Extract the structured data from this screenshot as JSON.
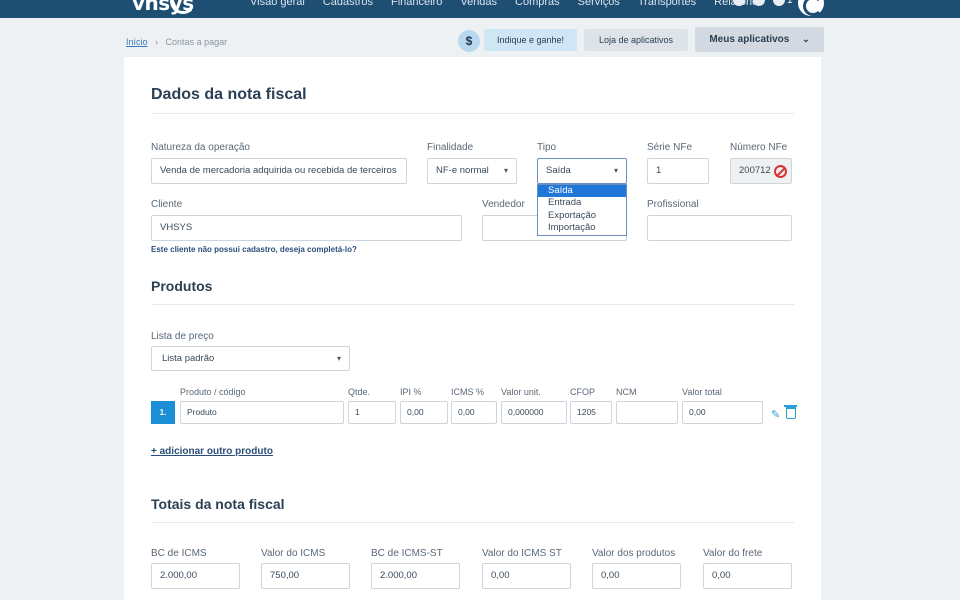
{
  "header": {
    "logo_text": "vhsys",
    "nav": [
      "Visão geral",
      "Cadastros",
      "Financeiro",
      "Vendas",
      "Compras",
      "Serviços",
      "Transportes",
      "Relatórios"
    ],
    "notification_count": "1"
  },
  "breadcrumb": {
    "home": "Início",
    "separator": "›",
    "current": "Contas a pagar"
  },
  "actions": {
    "dollar_symbol": "$",
    "indique": "Indique e ganhe!",
    "loja": "Loja de aplicativos",
    "meus": "Meus aplicativos",
    "meus_chevron": "⌄"
  },
  "form": {
    "title": "Dados da nota fiscal",
    "natureza": {
      "label": "Natureza da operação",
      "value": "Venda de mercadoria adquirida ou recebida de terceiros"
    },
    "finalidade": {
      "label": "Finalidade",
      "value": "NF-e normal"
    },
    "tipo": {
      "label": "Tipo",
      "value": "Saída",
      "options": [
        "Saída",
        "Entrada",
        "Exportação",
        "Importação"
      ]
    },
    "serie": {
      "label": "Série NFe",
      "value": "1"
    },
    "numero": {
      "label": "Número NFe",
      "value": "200712"
    },
    "cliente": {
      "label": "Cliente",
      "value": "VHSYS",
      "hint": "Este cliente não possui cadastro, deseja completá-lo?"
    },
    "vendedor": {
      "label": "Vendedor",
      "value": ""
    },
    "profissional": {
      "label": "Profissional",
      "value": ""
    }
  },
  "produtos": {
    "title": "Produtos",
    "lista_label": "Lista de preço",
    "lista_value": "Lista padrão",
    "columns": [
      "Produto / código",
      "Qtde.",
      "IPI %",
      "ICMS %",
      "Valor unit.",
      "CFOP",
      "NCM",
      "Valor total"
    ],
    "row": {
      "index": "1.",
      "produto": "Produto",
      "qtde": "1",
      "ipi": "0,00",
      "icms": "0,00",
      "valor_unit": "0,000000",
      "cfop": "1205",
      "ncm": "",
      "valor_total": "0,00"
    },
    "add_link": "+ adicionar outro produto",
    "edit_glyph": "✎"
  },
  "totais": {
    "title": "Totais da nota fiscal",
    "fields": [
      {
        "label": "BC de ICMS",
        "value": "2.000,00"
      },
      {
        "label": "Valor do ICMS",
        "value": "750,00"
      },
      {
        "label": "BC de ICMS-ST",
        "value": "2.000,00"
      },
      {
        "label": "Valor do ICMS ST",
        "value": "0,00"
      },
      {
        "label": "Valor dos produtos",
        "value": "0,00"
      },
      {
        "label": "Valor do frete",
        "value": "0,00"
      }
    ]
  }
}
